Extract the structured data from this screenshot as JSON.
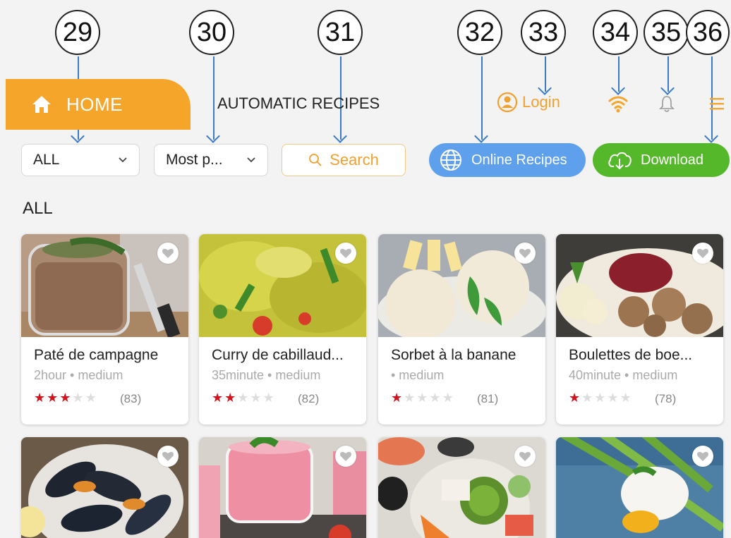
{
  "callouts": [
    "29",
    "30",
    "31",
    "32",
    "33",
    "34",
    "35",
    "36"
  ],
  "header": {
    "home_label": "HOME",
    "page_title": "AUTOMATIC RECIPES",
    "login_label": "Login"
  },
  "filters": {
    "category_value": "ALL",
    "sort_value": "Most p...",
    "search_label": "Search",
    "online_label": "Online Recipes",
    "download_label": "Download"
  },
  "section_label": "ALL",
  "recipes": [
    {
      "name": "Paté de campagne",
      "meta": "2hour • medium",
      "rating": 3,
      "count": "(83)"
    },
    {
      "name": "Curry de cabillaud...",
      "meta": "35minute • medium",
      "rating": 2,
      "count": "(82)"
    },
    {
      "name": "Sorbet à la banane",
      "meta": "• medium",
      "rating": 1,
      "count": "(81)"
    },
    {
      "name": "Boulettes de boe...",
      "meta": "40minute • medium",
      "rating": 1,
      "count": "(78)"
    }
  ],
  "colors": {
    "accent": "#f4a52a",
    "online": "#5ea0ec",
    "download": "#55b82a",
    "star": "#d2141e"
  },
  "icons": [
    "home-icon",
    "user-icon",
    "wifi-icon",
    "bell-icon",
    "menu-icon",
    "chevron-down-icon",
    "search-icon",
    "globe-icon",
    "cloud-download-icon",
    "heart-icon",
    "star-icon"
  ]
}
